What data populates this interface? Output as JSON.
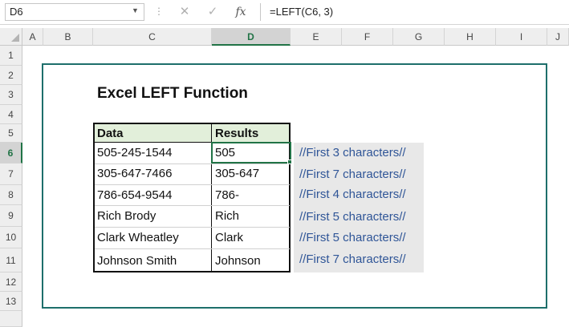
{
  "formula_bar": {
    "name_box": "D6",
    "cancel_glyph": "✕",
    "enter_glyph": "✓",
    "fx_label": "fx",
    "formula": "=LEFT(C6, 3)"
  },
  "columns": [
    "A",
    "B",
    "C",
    "D",
    "E",
    "F",
    "G",
    "H",
    "I",
    "J"
  ],
  "rows": [
    "1",
    "2",
    "3",
    "4",
    "5",
    "6",
    "7",
    "8",
    "9",
    "10",
    "11",
    "12",
    "13"
  ],
  "title": "Excel LEFT Function",
  "table": {
    "headers": [
      "Data",
      "Results"
    ],
    "rows": [
      {
        "data": "505-245-1544",
        "result": "505",
        "note": "//First 3 characters//"
      },
      {
        "data": "305-647-7466",
        "result": "305-647",
        "note": "//First 7 characters//"
      },
      {
        "data": "786-654-9544",
        "result": "786-",
        "note": "//First 4 characters//"
      },
      {
        "data": "Rich Brody",
        "result": "Rich",
        "note": "//First 5 characters//"
      },
      {
        "data": "Clark Wheatley",
        "result": "Clark",
        "note": "//First 5 characters//"
      },
      {
        "data": "Johnson Smith",
        "result": "Johnson",
        "note": "//First 7 characters//"
      }
    ]
  },
  "colors": {
    "header_fill": "#e2efda",
    "frame": "#1e6f6b",
    "comment_text": "#2f5597",
    "selection": "#217346"
  }
}
